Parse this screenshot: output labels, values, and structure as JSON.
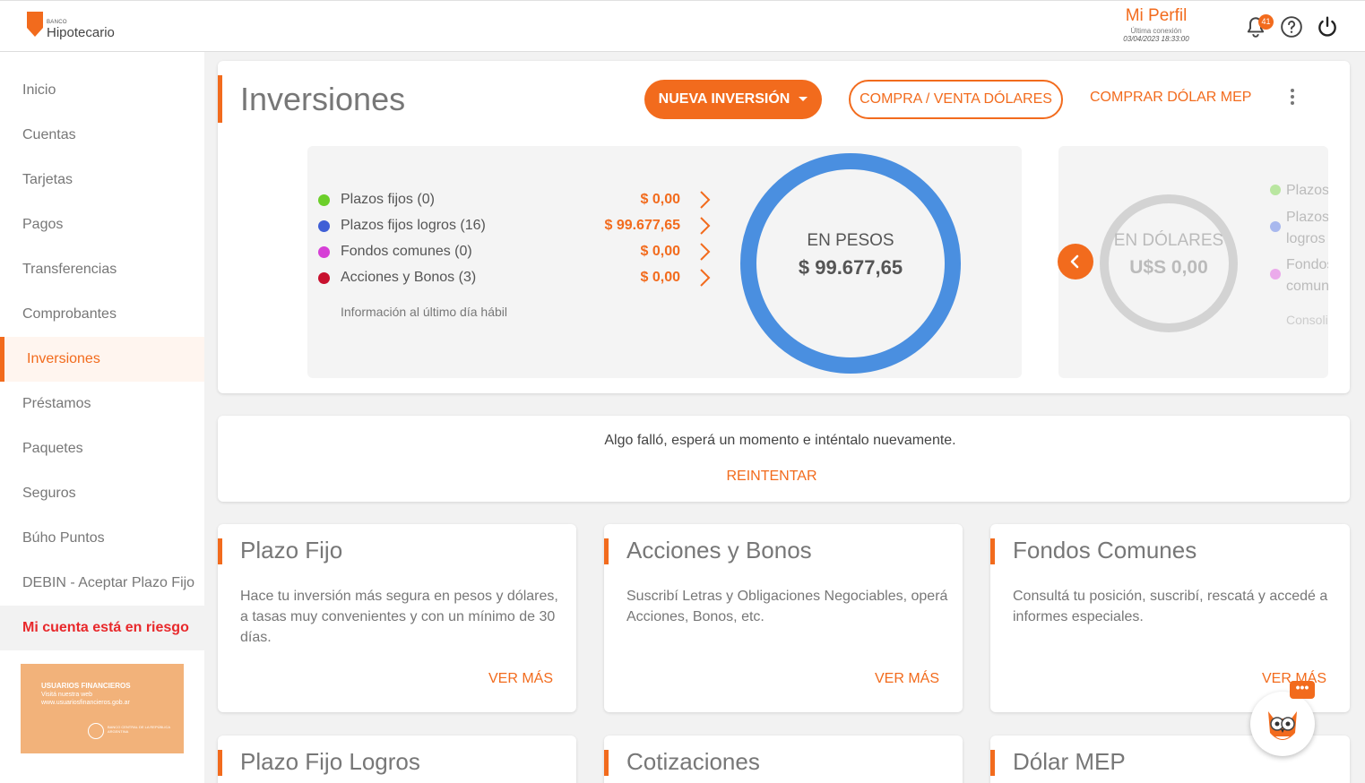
{
  "header": {
    "logo_small": "BANCO",
    "logo_name": "Hipotecario",
    "profile_name": "Mi Perfil",
    "last_connection_label": "Última conexión",
    "last_connection_date": "03/04/2023 18:33:00",
    "notifications_count": "41",
    "icons": [
      "bell-icon",
      "help-icon",
      "power-icon"
    ]
  },
  "sidebar": {
    "items": [
      {
        "label": "Inicio"
      },
      {
        "label": "Cuentas"
      },
      {
        "label": "Tarjetas"
      },
      {
        "label": "Pagos"
      },
      {
        "label": "Transferencias"
      },
      {
        "label": "Comprobantes"
      },
      {
        "label": "Inversiones",
        "active": true
      },
      {
        "label": "Préstamos"
      },
      {
        "label": "Paquetes"
      },
      {
        "label": "Seguros"
      },
      {
        "label": "Búho Puntos"
      },
      {
        "label": "DEBIN - Aceptar Plazo Fijo"
      },
      {
        "label": "Mi cuenta está en riesgo"
      }
    ],
    "banner": {
      "title": "USUARIOS FINANCIEROS",
      "line1": "Visitá nuestra web",
      "line2": "www.usuariosfinancieros.gob.ar",
      "seal_text": "BANCO CENTRAL DE LA REPÚBLICA ARGENTINA"
    }
  },
  "investments": {
    "title": "Inversiones",
    "new_investment": "NUEVA INVERSIÓN",
    "buy_sell_dollars": "COMPRA / VENTA DÓLARES",
    "buy_mep": "COMPRAR DÓLAR MEP",
    "pesos": {
      "rows": [
        {
          "label": "Plazos fijos (0)",
          "value": "$ 0,00",
          "color": "#6ccf2a"
        },
        {
          "label": "Plazos fijos logros (16)",
          "value": "$ 99.677,65",
          "color": "#3f5fd6"
        },
        {
          "label": "Fondos comunes (0)",
          "value": "$ 0,00",
          "color": "#d63fd6"
        },
        {
          "label": "Acciones y Bonos (3)",
          "value": "$ 0,00",
          "color": "#c8102e"
        }
      ],
      "note": "Información al último día hábil",
      "donut_label": "EN PESOS",
      "donut_value": "$ 99.677,65",
      "donut_color": "#4a8fe0"
    },
    "dollars": {
      "donut_label": "EN DÓLARES",
      "donut_value": "U$S 0,00",
      "item1a": "Plazos",
      "item2a": "Plazos",
      "item2b": "logros",
      "item3a": "Fondos",
      "item3b": "comun",
      "note": "Consoli"
    }
  },
  "error": {
    "message": "Algo falló, esperá un momento e inténtalo nuevamente.",
    "retry": "REINTENTAR"
  },
  "products": [
    {
      "title": "Plazo Fijo",
      "desc": "Hace tu inversión más segura en pesos y dólares, a tasas muy convenientes y con un mínimo de 30 días.",
      "more": "VER MÁS"
    },
    {
      "title": "Acciones y Bonos",
      "desc": "Suscribí Letras y Obligaciones Negociables, operá Acciones, Bonos, etc.",
      "more": "VER MÁS"
    },
    {
      "title": "Fondos Comunes",
      "desc": "Consultá tu posición, suscribí, rescatá y accedé a informes especiales.",
      "more": "VER MÁS"
    }
  ],
  "products_row2": [
    {
      "title": "Plazo Fijo Logros"
    },
    {
      "title": "Cotizaciones"
    },
    {
      "title": "Dólar MEP"
    }
  ],
  "chat_bubble": "•••"
}
